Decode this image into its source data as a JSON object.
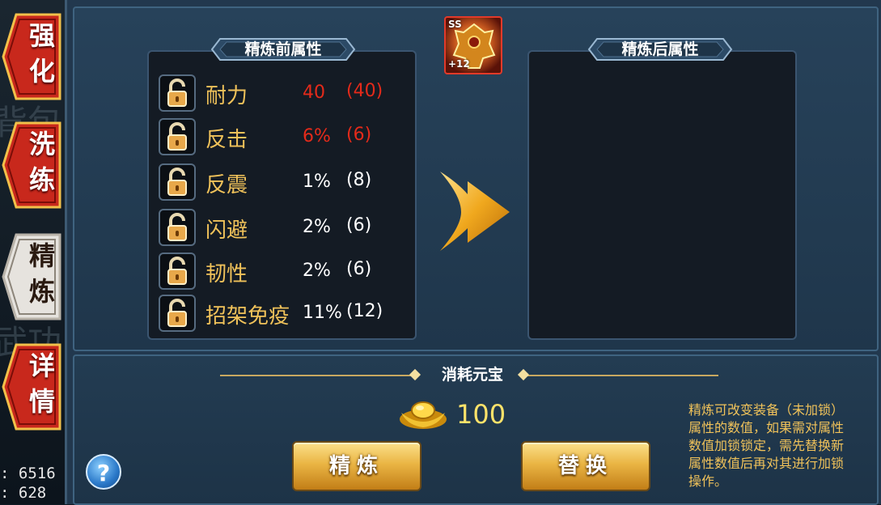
{
  "side_tabs": [
    {
      "line1": "强",
      "line2": "化"
    },
    {
      "line1": "洗",
      "line2": "练"
    },
    {
      "line1": "精",
      "line2": "炼"
    },
    {
      "line1": "详",
      "line2": "情"
    }
  ],
  "left_stats": [
    ": 6516",
    ": 628"
  ],
  "item": {
    "grade": "SS",
    "level": "+12"
  },
  "before_panel": {
    "title": "精炼前属性",
    "attributes": [
      {
        "name": "耐力",
        "value": "40",
        "max": "(40)",
        "color": "#e42a1a"
      },
      {
        "name": "反击",
        "value": "6%",
        "max": "(6)",
        "color": "#e42a1a"
      },
      {
        "name": "反震",
        "value": "1%",
        "max": "(8)",
        "color": "#ffffff"
      },
      {
        "name": "闪避",
        "value": "2%",
        "max": "(6)",
        "color": "#ffffff"
      },
      {
        "name": "韧性",
        "value": "2%",
        "max": "(6)",
        "color": "#ffffff"
      },
      {
        "name": "招架免疫",
        "value": "11%",
        "max": "(12)",
        "color": "#ffffff"
      }
    ]
  },
  "after_panel": {
    "title": "精炼后属性"
  },
  "cost": {
    "title": "消耗元宝",
    "amount": "100"
  },
  "buttons": {
    "refine": "精炼",
    "replace": "替换",
    "help": "?"
  },
  "note": [
    "精炼可改变装备（未加锁）",
    "属性的数值，如果需对属性",
    "数值加锁锁定，需先替换新",
    "属性数值后再对其进行加锁",
    "操作。"
  ],
  "colors": {
    "gold_text": "#f0c25a",
    "red_value": "#e42a1a",
    "cost_number": "#ffe36a"
  }
}
